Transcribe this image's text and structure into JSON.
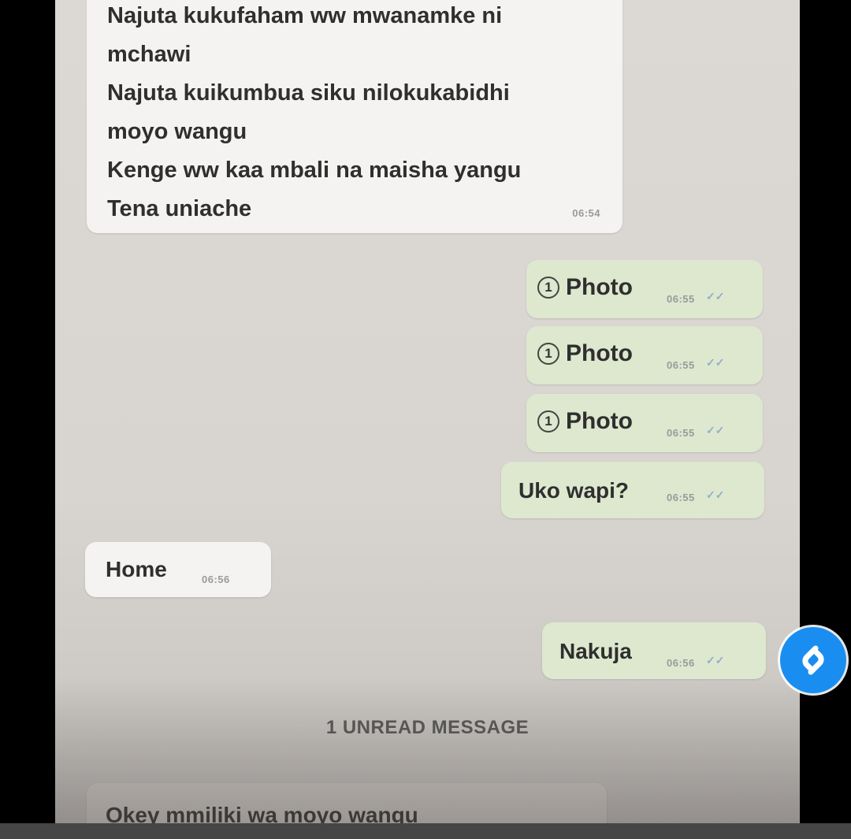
{
  "messages": {
    "incoming_1": {
      "lines": [
        "Najuta kukufaham ww mwanamke ni",
        "mchawi",
        "Najuta kuikumbua siku nilokukabidhi",
        "moyo wangu",
        "Kenge ww kaa mbali na maisha yangu",
        "Tena uniache"
      ],
      "time": "06:54"
    },
    "outgoing_photos": [
      {
        "icon": "1",
        "label": "Photo",
        "time": "06:55"
      },
      {
        "icon": "1",
        "label": "Photo",
        "time": "06:55"
      },
      {
        "icon": "1",
        "label": "Photo",
        "time": "06:55"
      }
    ],
    "outgoing_question": {
      "text": "Uko wapi?",
      "time": "06:55"
    },
    "incoming_home": {
      "text": "Home",
      "time": "06:56"
    },
    "outgoing_nakuja": {
      "text": "Nakuja",
      "time": "06:56"
    },
    "unread_divider": "1 UNREAD MESSAGE",
    "incoming_last": {
      "text": "Okey mmiliki wa moyo wangu"
    }
  },
  "ticks_glyph": "✓✓",
  "overlay": {
    "icon": "shazam-icon",
    "color": "#1a8ef0"
  }
}
